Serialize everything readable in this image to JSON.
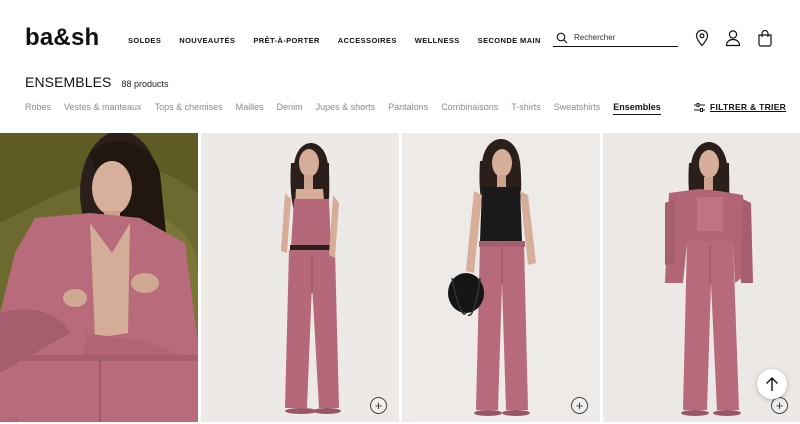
{
  "brand": {
    "logo": "ba&sh"
  },
  "nav": [
    "SOLDES",
    "NOUVEAUTÉS",
    "PRÊT-À-PORTER",
    "ACCESSOIRES",
    "WELLNESS",
    "SECONDE MAIN"
  ],
  "search": {
    "placeholder": "Rechercher",
    "value": ""
  },
  "header_icons": [
    "location-pin-icon",
    "account-icon",
    "shopping-bag-icon"
  ],
  "page": {
    "title": "ENSEMBLES",
    "count": "88 products"
  },
  "categories": [
    {
      "label": "Robes",
      "active": false
    },
    {
      "label": "Vestes & manteaux",
      "active": false
    },
    {
      "label": "Tops & chemises",
      "active": false
    },
    {
      "label": "Mailles",
      "active": false
    },
    {
      "label": "Denim",
      "active": false
    },
    {
      "label": "Jupes & shorts",
      "active": false
    },
    {
      "label": "Pantalons",
      "active": false
    },
    {
      "label": "Combinaisons",
      "active": false
    },
    {
      "label": "T-shirts",
      "active": false
    },
    {
      "label": "Sweatshirts",
      "active": false
    },
    {
      "label": "Ensembles",
      "active": true
    }
  ],
  "filter": {
    "label": "FILTRER & TRIER"
  },
  "products": [
    {
      "name": "product-1",
      "quick_add": "+"
    },
    {
      "name": "product-2",
      "quick_add": "+"
    },
    {
      "name": "product-3",
      "quick_add": "+"
    },
    {
      "name": "product-4",
      "quick_add": "+"
    }
  ],
  "colors": {
    "accent": "#111111",
    "garment": "#b66a78",
    "inactive_category": "#8a8a8a",
    "photo_bg": "#ece9e6"
  }
}
